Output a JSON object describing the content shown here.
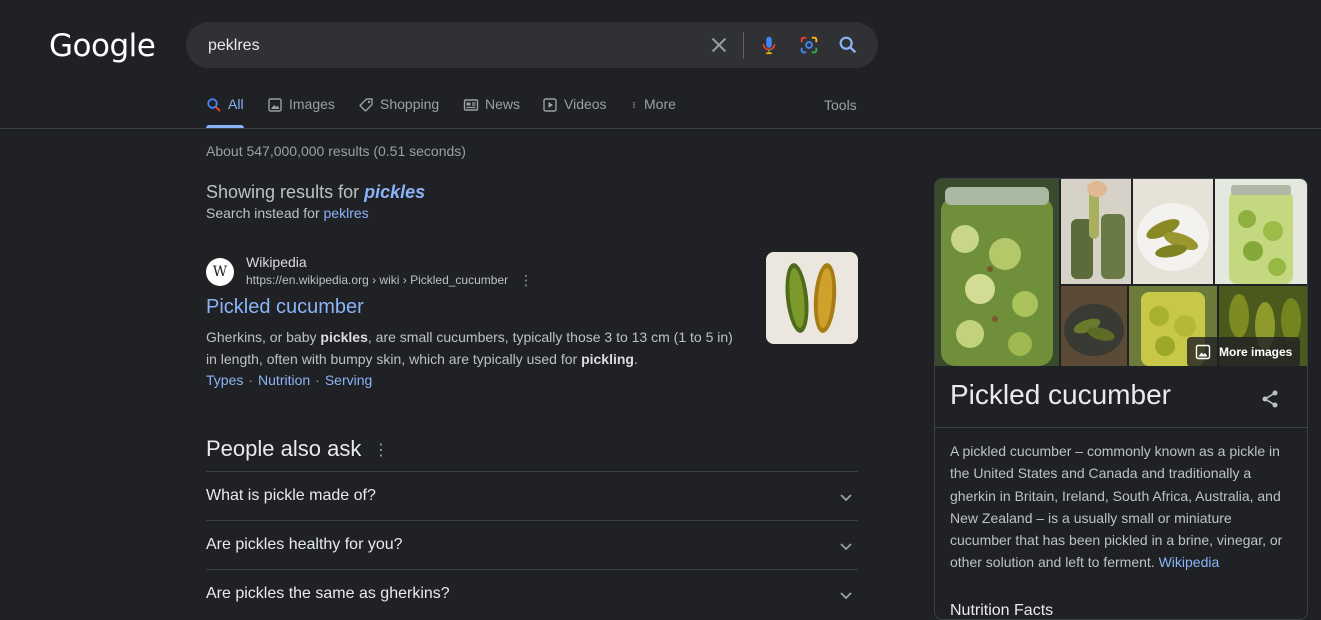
{
  "logo": "Google",
  "search": {
    "query": "peklres"
  },
  "tabs": [
    {
      "label": "All",
      "icon": "search-icon"
    },
    {
      "label": "Images",
      "icon": "image-icon"
    },
    {
      "label": "Shopping",
      "icon": "tag-icon"
    },
    {
      "label": "News",
      "icon": "news-icon"
    },
    {
      "label": "Videos",
      "icon": "play-icon"
    },
    {
      "label": "More",
      "icon": "more-vert-icon"
    }
  ],
  "tools_label": "Tools",
  "result_stats": "About 547,000,000 results (0.51 seconds)",
  "spelling": {
    "showing_prefix": "Showing results for ",
    "corrected": "pickles",
    "instead_prefix": "Search instead for ",
    "original": "peklres"
  },
  "result": {
    "favicon": "W",
    "site_name": "Wikipedia",
    "cite": "https://en.wikipedia.org › wiki › Pickled_cucumber",
    "title": "Pickled cucumber",
    "snippet": {
      "p1": "Gherkins, or baby ",
      "b1": "pickles",
      "p2": ", are small cucumbers, typically those 3 to 13 cm (1 to 5 in) in length, often with bumpy skin, which are typically used for ",
      "b2": "pickling",
      "p3": "."
    },
    "sublinks": [
      "Types",
      "Nutrition",
      "Serving"
    ],
    "separator": "·"
  },
  "people_also_ask": {
    "title": "People also ask",
    "questions": [
      "What is pickle made of?",
      "Are pickles healthy for you?",
      "Are pickles the same as gherkins?"
    ]
  },
  "knowledge_panel": {
    "more_images": "More images",
    "title": "Pickled cucumber",
    "description": "A pickled cucumber – commonly known as a pickle in the United States and Canada and traditionally a gherkin in Britain, Ireland, South Africa, Australia, and New Zealand – is a usually small or miniature cucumber that has been pickled in a brine, vinegar, or other solution and left to ferment. ",
    "source_link": "Wikipedia",
    "next_section": "Nutrition Facts"
  },
  "colors": {
    "background": "#202124",
    "link": "#8ab4f8",
    "text": "#bdc1c6",
    "heading": "#e8eaed"
  }
}
